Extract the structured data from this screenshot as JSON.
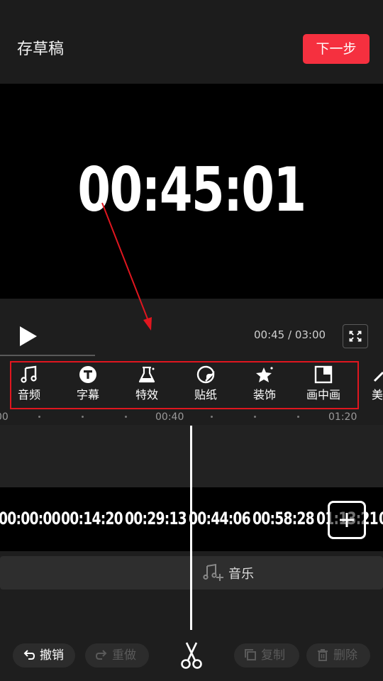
{
  "header": {
    "draft_label": "存草稿",
    "next_label": "下一步",
    "next_color": "#f5303f"
  },
  "preview": {
    "timecode": "00:45:01"
  },
  "playback": {
    "current_time": "00:45",
    "total_time": "03:00",
    "time_readout": "00:45 / 03:00",
    "progress": 0.25
  },
  "toolbar": {
    "items": [
      {
        "label": "音频",
        "icon": "music-note-icon"
      },
      {
        "label": "字幕",
        "icon": "text-t-icon"
      },
      {
        "label": "特效",
        "icon": "flask-sparkle-icon"
      },
      {
        "label": "贴纸",
        "icon": "sticker-icon"
      },
      {
        "label": "装饰",
        "icon": "star-sparkle-icon"
      },
      {
        "label": "画中画",
        "icon": "picture-in-picture-icon"
      },
      {
        "label": "美",
        "icon": "magic-wand-icon"
      }
    ],
    "highlight_color": "#e0161f"
  },
  "ruler": {
    "labels": [
      "00",
      "00:40",
      "01:20"
    ]
  },
  "video_track": {
    "frames": [
      "00:00:00",
      "00:14:20",
      "00:29:13",
      "00:44:06",
      "00:58:28",
      "01:13:21",
      "0"
    ]
  },
  "audio_track": {
    "label": "音乐"
  },
  "bottom_bar": {
    "undo_label": "撤销",
    "redo_label": "重做",
    "copy_label": "复制",
    "delete_label": "删除"
  }
}
